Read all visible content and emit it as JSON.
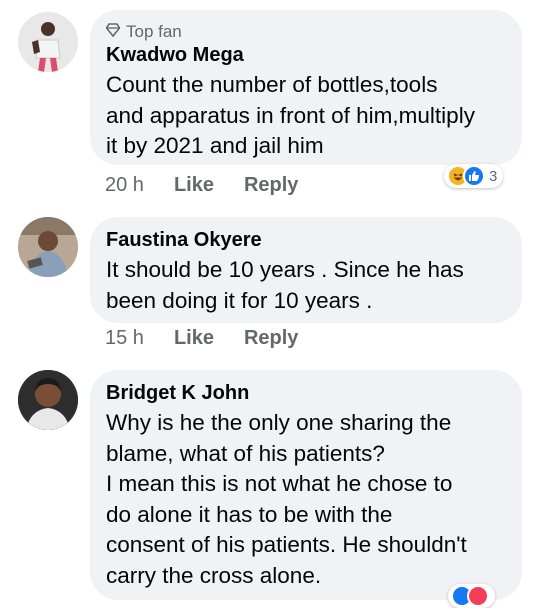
{
  "comments": [
    {
      "badge": "Top fan",
      "author": "Kwadwo Mega",
      "text_lines": [
        "Count the number of bottles,tools",
        "and apparatus in front of him,multiply",
        "it by 2021 and jail him"
      ],
      "time": "20 h",
      "like_label": "Like",
      "reply_label": "Reply",
      "reaction_count": "3"
    },
    {
      "author": "Faustina Okyere",
      "text_lines": [
        "It should  be 10 years . Since he has",
        "been doing it for 10 years ."
      ],
      "time": "15 h",
      "like_label": "Like",
      "reply_label": "Reply"
    },
    {
      "author": "Bridget K John",
      "text_lines": [
        "Why is he the only one sharing the",
        "blame, what of his patients?",
        "I mean this is not what he chose to",
        "do alone it has to be with the",
        "consent of his patients. He shouldn't",
        "carry the cross alone."
      ]
    }
  ],
  "icons": {
    "badge": "diamond-badge-icon",
    "reactions_1": [
      "haha-icon",
      "like-icon"
    ],
    "reactions_3": [
      "like-icon",
      "love-icon"
    ]
  },
  "colors": {
    "bubble": "#f0f2f5",
    "meta": "#65676b",
    "like_blue": "#1877f2",
    "haha_yellow": "#f7b125",
    "love_red": "#f33e58"
  }
}
